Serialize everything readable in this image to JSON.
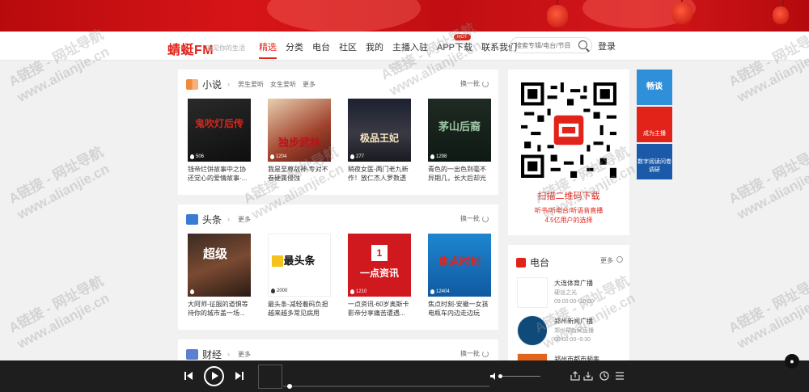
{
  "brand": {
    "name": "蜻蜓FM",
    "slogan": "听见你的生活",
    "accent": "#e2231a"
  },
  "nav": {
    "items": [
      "精选",
      "分类",
      "电台",
      "社区",
      "我的",
      "主播入驻",
      "APP下载",
      "联系我们"
    ],
    "hot_badge": "HOT",
    "search_placeholder": "搜索专辑/电台/节目",
    "login": "登录"
  },
  "novel": {
    "title": "小说",
    "subs": [
      "男生爱听",
      "女生爱听",
      "更多"
    ],
    "refresh": "换一批",
    "items": [
      {
        "cover_text": "鬼吹灯后传",
        "plays": "506",
        "title": "钱帝烂饼故事中之协还党心的爱情故事·..."
      },
      {
        "cover_text": "独步武林",
        "plays": "1204",
        "title": "我是至尊战神-专对不卷硬属侵蚀"
      },
      {
        "cover_text": "极品王妃",
        "plays": "277",
        "title": "稍夜女医-两门老九新作！放仁杰人罗数透案"
      },
      {
        "cover_text": "茅山后裔",
        "plays": "1298",
        "title": "青色的一出色到毫不异期几，长大后却光芒..."
      }
    ]
  },
  "headline": {
    "title": "头条",
    "subs": [
      "更多"
    ],
    "refresh": "换一批",
    "items": [
      {
        "cover_text": "超级",
        "plays": "",
        "title": "大阿师-征服的道惧等待你的城市盖一场..."
      },
      {
        "cover_text": "最头条",
        "plays": "2000",
        "title": "最头条-减轻着码负担越来越多常见病用药..."
      },
      {
        "cover_text": "一点资讯",
        "plays": "1210",
        "title": "一点资讯-60岁奥斯卡影帝分享痛苦遭遇..."
      },
      {
        "cover_text": "焦点时刻",
        "plays": "12404",
        "title": "焦点时刻-安徽一女孩电瓶车内边走边玩手..."
      }
    ]
  },
  "finance": {
    "title": "财经",
    "subs": [
      "更多"
    ],
    "refresh": "换一批"
  },
  "qr": {
    "title": "扫描二维码下载",
    "line1": "听书/听电台/听语音直播",
    "line2": "4.5亿用户的选择"
  },
  "radio": {
    "title": "电台",
    "more": "更多",
    "stations": [
      {
        "name": "大连体育广播",
        "host": "硬派之光",
        "time": "09:00:00~10:00"
      },
      {
        "name": "郑州新闻广播",
        "host": "郑州早新闻直播",
        "time": "09:00:00~9:30"
      },
      {
        "name": "郑州市都市频率",
        "host": "",
        "time": ""
      }
    ]
  },
  "float_buttons": [
    "畅谈",
    "成为主播",
    "数字阅读问卷调研"
  ],
  "player": {
    "progress": 0.02,
    "volume": 0.0
  },
  "watermark": {
    "line1": "A链接 - 网址导航",
    "line2": "www.alianjie.cn"
  },
  "colors": {
    "accent": "#e2231a",
    "player_bg": "#1e1e1e",
    "page_bg": "#f1f1f1"
  }
}
